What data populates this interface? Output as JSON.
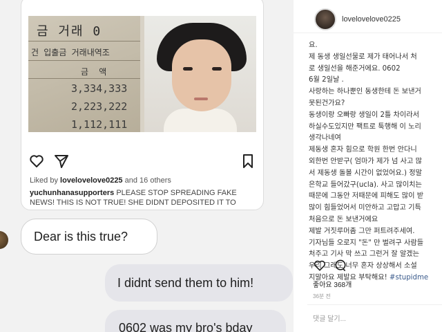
{
  "embed": {
    "receipt": {
      "title": "금 거래 0",
      "subtitle": "건 입출금 거래내역조",
      "header": "금 액",
      "amounts": [
        "3,334,333",
        "2,223,222",
        "1,112,111"
      ]
    },
    "likes_prefix": "Liked by",
    "likes_user": "lovelovelove0225",
    "likes_suffix": "and 16 others",
    "comment_user": "yuchunhanasupporters",
    "comment_text": "PLEASE STOP SPREADING FAKE NEWS! THIS IS NOT TRUE! SHE DIDNT DEPOSITED IT TO"
  },
  "chat": {
    "incoming": "Dear is this true?",
    "outgoing": [
      "I didnt send them to him!",
      "0602 was my bro's bday"
    ]
  },
  "instagram": {
    "username": "lovelovelove0225",
    "caption_lines": [
      "요.",
      "제 동생 생일선물로 제가 태어나서 처",
      "로 생일선을 해준거에요. 0602",
      "6월 2일날 .",
      "사랑하는 하나뿐인 동생한테 돈 보낸거",
      "못된건가요?",
      "동생이랑 오빠랑 생일이 2틀 차이라서",
      "하실수도있지만 팩트로 툭행해 이 노리",
      "생각나네여",
      "제동생 혼자 힘으로 학원 한번 안다니",
      "외한번 안받구( 엄마가 제가 넘 사고 많",
      "서 제동생 돌볼 시간이 없었어요.) 정말",
      "은학교 들어갔구(ucla). 사고 많이치는",
      "때문에 그동안 저때문에 피해도 많이 받",
      "많이 힘들었어서 미안하고 고맙고 기특",
      "처음으로 돈 보낸거에요",
      "제발 거짓루머좀 그만 퍼트려주세여.",
      "기자님들 오로지 \"돈\" 만 벌려구 사람들",
      "처주고 기사 막 쓰고 그런거 잘 알겠는",
      "우리 그래도 너무 혼자 상상해서 소설",
      "지말아요 제발요 부탁해요! #stupidme"
    ],
    "likes": "좋아요 368개",
    "time": "36분 전",
    "comment_placeholder": "댓글 달기..."
  }
}
